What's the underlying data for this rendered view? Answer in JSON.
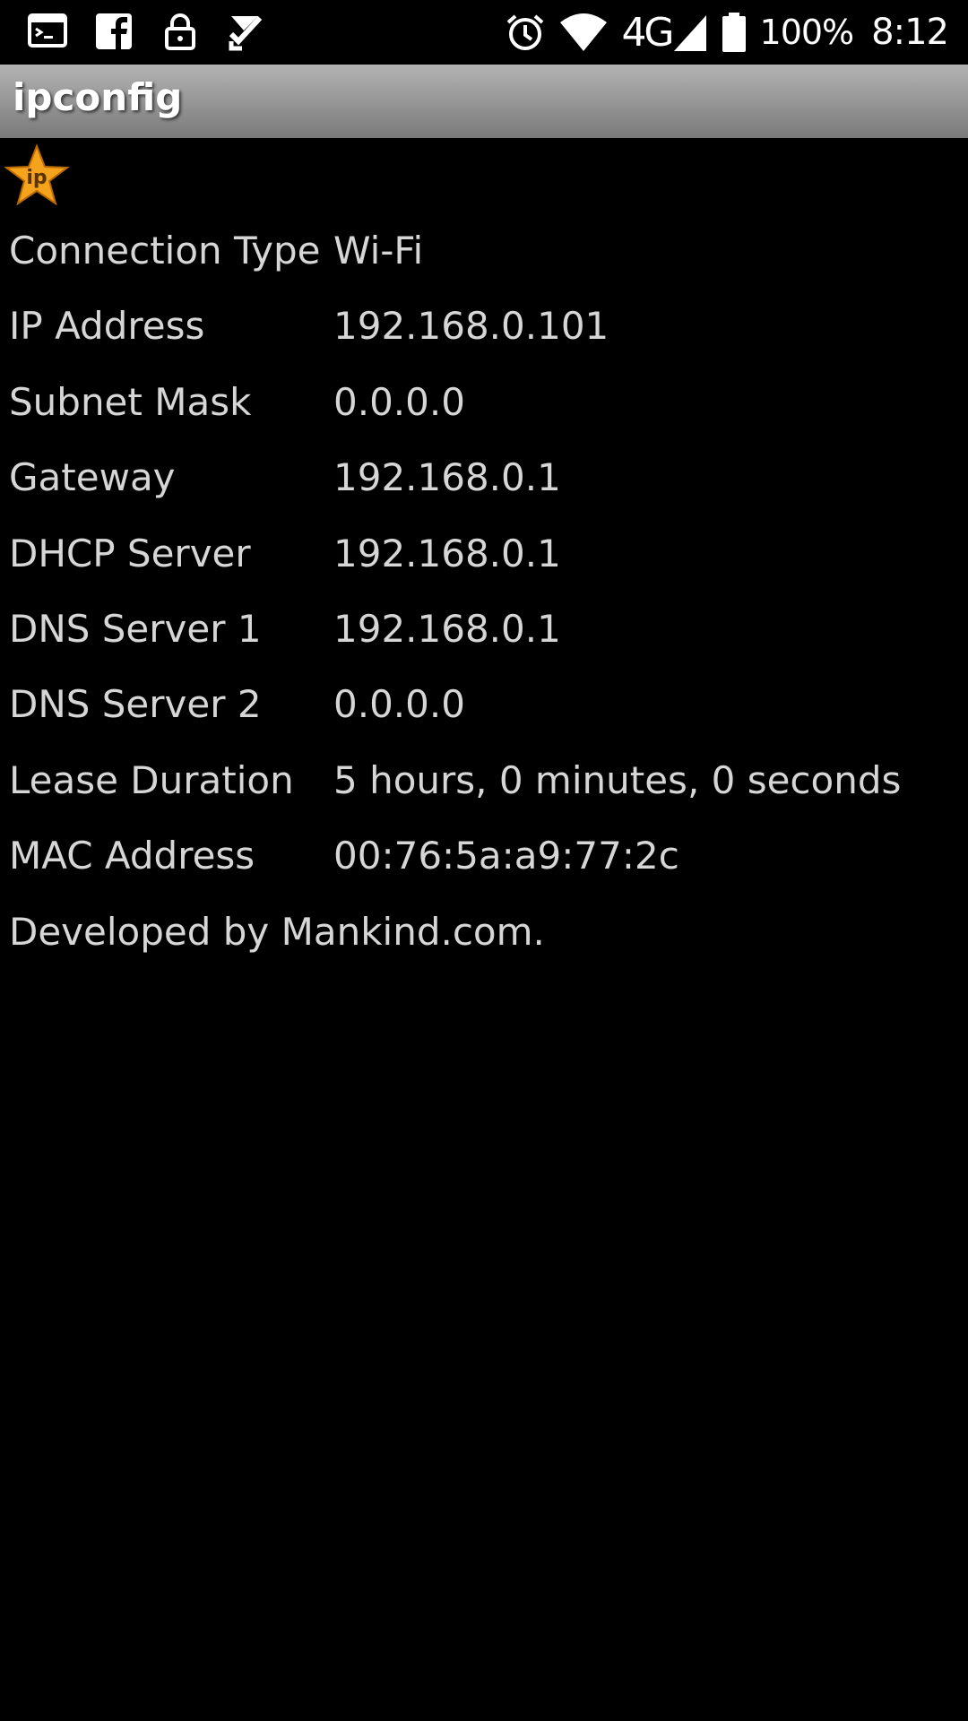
{
  "status_bar": {
    "left_icons": [
      "terminal-icon",
      "facebook-icon",
      "lock-icon",
      "checklist-icon"
    ],
    "right_icons": [
      "alarm-icon",
      "wifi-icon",
      "cellular-signal-icon",
      "battery-icon"
    ],
    "network_type": "4G",
    "battery_percent": "100%",
    "time": "8:12"
  },
  "app": {
    "title": "ipconfig",
    "logo_text": "ip",
    "logo_color": "#f5a21d"
  },
  "rows": [
    {
      "label": "Connection Type",
      "value": "Wi-Fi"
    },
    {
      "label": "IP Address",
      "value": "192.168.0.101"
    },
    {
      "label": "Subnet Mask",
      "value": "0.0.0.0"
    },
    {
      "label": "Gateway",
      "value": "192.168.0.1"
    },
    {
      "label": "DHCP Server",
      "value": "192.168.0.1"
    },
    {
      "label": "DNS Server 1",
      "value": "192.168.0.1"
    },
    {
      "label": "DNS Server 2",
      "value": "0.0.0.0"
    },
    {
      "label": "Lease Duration",
      "value": "5 hours, 0 minutes, 0 seconds"
    },
    {
      "label": "MAC Address",
      "value": "00:76:5a:a9:77:2c"
    }
  ],
  "footer": "Developed by Mankind.com."
}
